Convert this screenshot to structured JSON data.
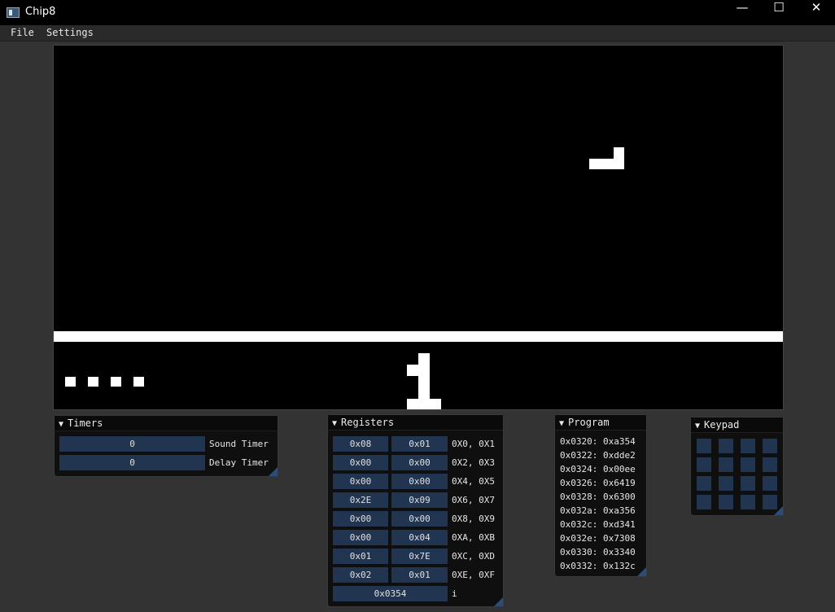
{
  "window": {
    "title": "Chip8",
    "minimize": "—",
    "maximize": "☐",
    "close": "✕"
  },
  "menu": {
    "file": "File",
    "settings": "Settings"
  },
  "timers": {
    "title": "Timers",
    "sound_value": "0",
    "sound_label": "Sound Timer",
    "delay_value": "0",
    "delay_label": "Delay Timer"
  },
  "registers": {
    "title": "Registers",
    "rows": [
      {
        "a": "0x08",
        "b": "0x01",
        "label": "0X0, 0X1"
      },
      {
        "a": "0x00",
        "b": "0x00",
        "label": "0X2, 0X3"
      },
      {
        "a": "0x00",
        "b": "0x00",
        "label": "0X4, 0X5"
      },
      {
        "a": "0x2E",
        "b": "0x09",
        "label": "0X6, 0X7"
      },
      {
        "a": "0x00",
        "b": "0x00",
        "label": "0X8, 0X9"
      },
      {
        "a": "0x00",
        "b": "0x04",
        "label": "0XA, 0XB"
      },
      {
        "a": "0x01",
        "b": "0x7E",
        "label": "0XC, 0XD"
      },
      {
        "a": "0x02",
        "b": "0x01",
        "label": "0XE, 0XF"
      }
    ],
    "i_value": "0x0354",
    "i_label": "i"
  },
  "program": {
    "title": "Program",
    "lines": [
      "0x0320: 0xa354",
      "0x0322: 0xdde2",
      "0x0324: 0x00ee",
      "0x0326: 0x6419",
      "0x0328: 0x6300",
      "0x032a: 0xa356",
      "0x032c: 0xd341",
      "0x032e: 0x7308",
      "0x0330: 0x3340",
      "0x0332: 0x132c"
    ]
  },
  "keypad": {
    "title": "Keypad"
  },
  "colors": {
    "accent": "#213551",
    "background": "#333333",
    "screen": "#000000",
    "pixel": "#ffffff"
  }
}
